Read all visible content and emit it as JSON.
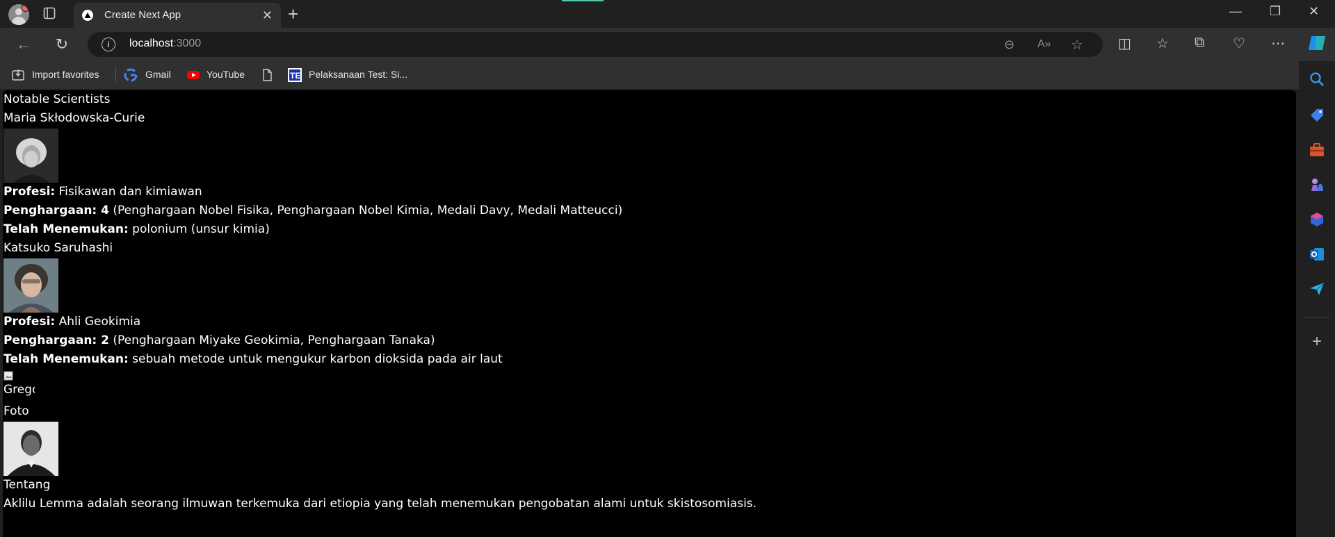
{
  "browser": {
    "tab_title": "Create Next App",
    "url_host": "localhost",
    "url_port": ":3000",
    "bookmarks": [
      {
        "label": "Import favorites",
        "icon": "import-icon"
      },
      {
        "label": "Gmail",
        "icon": "google-icon"
      },
      {
        "label": "YouTube",
        "icon": "youtube-icon"
      },
      {
        "label": "",
        "icon": "page-icon"
      },
      {
        "label": "Pelaksanaan Test: Si...",
        "icon": "te-icon"
      }
    ]
  },
  "page": {
    "heading": "Notable Scientists",
    "scientists": [
      {
        "name": "Maria Skłodowska-Curie",
        "profesi_label": "Profesi:",
        "profesi": "Fisikawan dan kimiawan",
        "award_label": "Penghargaan: 4",
        "awards": "(Penghargaan Nobel Fisika, Penghargaan Nobel Kimia, Medali Davy, Medali Matteucci)",
        "discovery_label": "Telah Menemukan:",
        "discovery": "polonium (unsur kimia)"
      },
      {
        "name": "Katsuko Saruhashi",
        "profesi_label": "Profesi:",
        "profesi": "Ahli Geokimia",
        "award_label": "Penghargaan: 2",
        "awards": "(Penghargaan Miyake Geokimia, Penghargaan Tanaka)",
        "discovery_label": "Telah Menemukan:",
        "discovery": "sebuah metode untuk mengukur karbon dioksida pada air laut"
      }
    ],
    "broken_image_alt": "Grego",
    "foto_label": "Foto",
    "tentang_label": "Tentang",
    "about_text": "Aklilu Lemma adalah seorang ilmuwan terkemuka dari etiopia yang telah menemukan pengobatan alami untuk skistosomiasis."
  },
  "colors": {
    "page_bg": "#000000",
    "chrome_bg": "#202020",
    "toolbar_bg": "#303030",
    "text": "#ffffff"
  }
}
